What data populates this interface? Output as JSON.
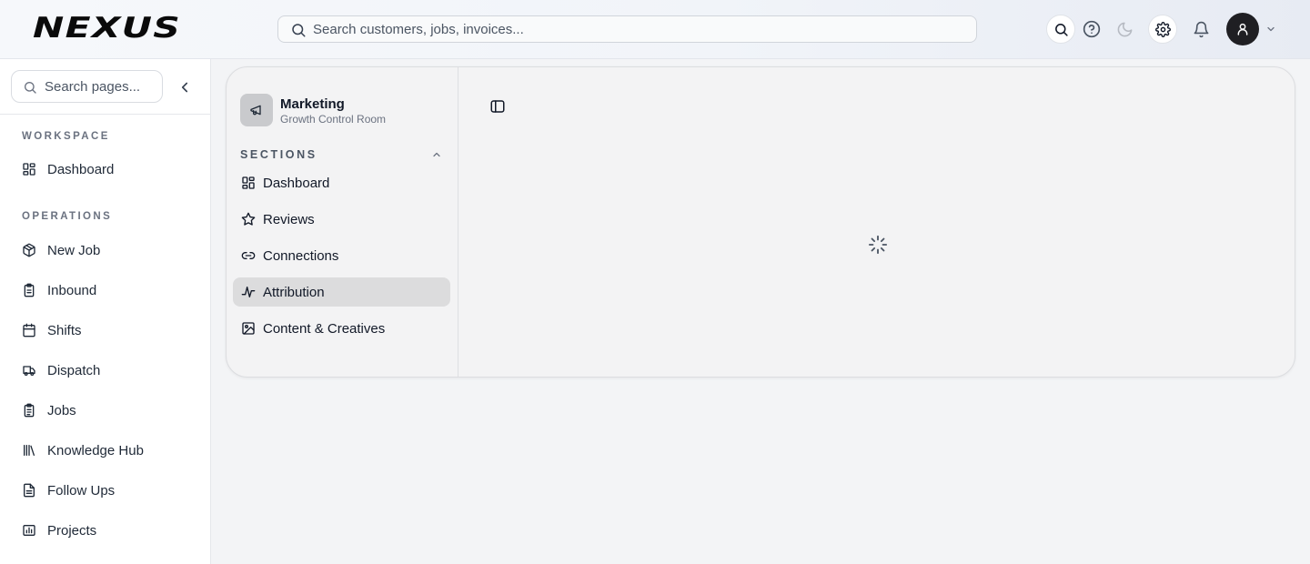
{
  "header": {
    "logo_text": "NEXUS",
    "search_placeholder": "Search customers, jobs, invoices..."
  },
  "sidebar": {
    "search_placeholder": "Search pages...",
    "groups": [
      {
        "label": "WORKSPACE",
        "items": [
          {
            "label": "Dashboard",
            "icon": "dashboard-icon"
          }
        ]
      },
      {
        "label": "OPERATIONS",
        "items": [
          {
            "label": "New Job",
            "icon": "package-icon"
          },
          {
            "label": "Inbound",
            "icon": "clipboard-icon"
          },
          {
            "label": "Shifts",
            "icon": "calendar-icon"
          },
          {
            "label": "Dispatch",
            "icon": "truck-icon"
          },
          {
            "label": "Jobs",
            "icon": "clipboard-list-icon"
          },
          {
            "label": "Knowledge Hub",
            "icon": "library-icon"
          },
          {
            "label": "Follow Ups",
            "icon": "file-text-icon"
          },
          {
            "label": "Projects",
            "icon": "chart-icon"
          }
        ]
      }
    ]
  },
  "module": {
    "title": "Marketing",
    "subtitle": "Growth Control Room",
    "icon": "megaphone-icon",
    "sections_label": "SECTIONS",
    "sections": [
      {
        "label": "Dashboard",
        "icon": "dashboard-icon",
        "active": false
      },
      {
        "label": "Reviews",
        "icon": "star-icon",
        "active": false
      },
      {
        "label": "Connections",
        "icon": "link-icon",
        "active": false
      },
      {
        "label": "Attribution",
        "icon": "activity-icon",
        "active": true
      },
      {
        "label": "Content & Creatives",
        "icon": "image-icon",
        "active": false
      }
    ]
  },
  "colors": {
    "active_section_bg": "#dcdcdd",
    "avatar_bg": "#1f1f23"
  }
}
